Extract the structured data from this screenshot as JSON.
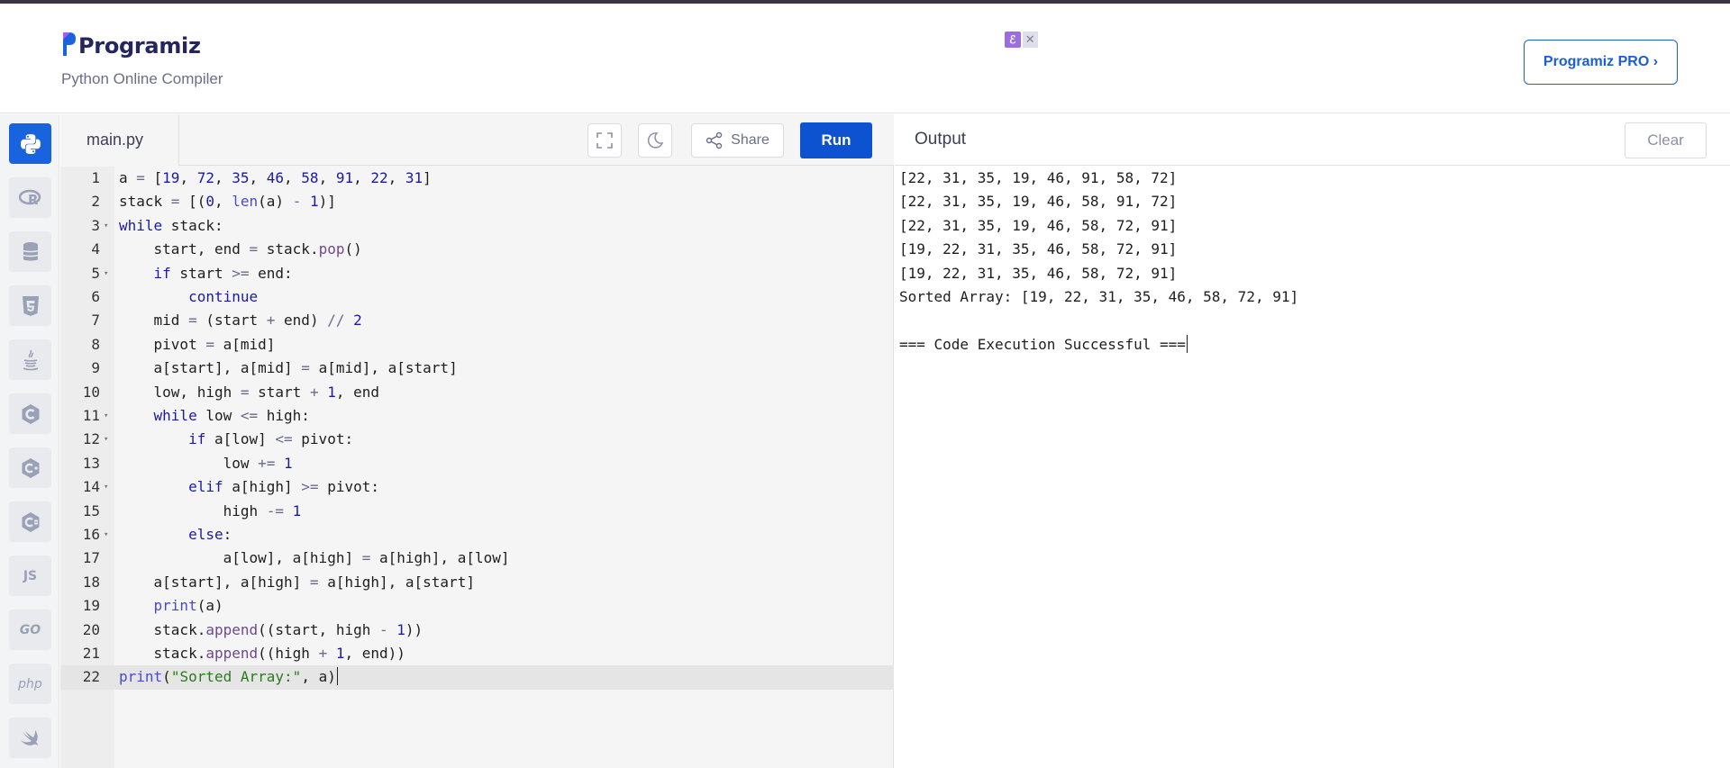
{
  "header": {
    "brand": "Programiz",
    "subtitle": "Python Online Compiler",
    "pro_button": "Programiz PRO ›"
  },
  "sidebar": {
    "items": [
      {
        "name": "python",
        "icon": "python-icon",
        "active": true
      },
      {
        "name": "r",
        "icon": "r-icon"
      },
      {
        "name": "sql",
        "icon": "database-icon"
      },
      {
        "name": "html",
        "icon": "html5-icon"
      },
      {
        "name": "java",
        "icon": "java-icon"
      },
      {
        "name": "c",
        "icon": "c-icon"
      },
      {
        "name": "cpp",
        "icon": "cpp-icon"
      },
      {
        "name": "csharp",
        "icon": "csharp-icon"
      },
      {
        "name": "js",
        "label": "JS",
        "icon": "js-icon"
      },
      {
        "name": "go",
        "label": "GO",
        "icon": "go-icon"
      },
      {
        "name": "php",
        "label": "php",
        "icon": "php-icon"
      },
      {
        "name": "swift",
        "icon": "swift-icon"
      }
    ]
  },
  "editor": {
    "filename": "main.py",
    "share_label": "Share",
    "run_label": "Run",
    "lines": [
      "a = [19, 72, 35, 46, 58, 91, 22, 31]",
      "stack = [(0, len(a) - 1)]",
      "while stack:",
      "    start, end = stack.pop()",
      "    if start >= end:",
      "        continue",
      "    mid = (start + end) // 2",
      "    pivot = a[mid]",
      "    a[start], a[mid] = a[mid], a[start]",
      "    low, high = start + 1, end",
      "    while low <= high:",
      "        if a[low] <= pivot:",
      "            low += 1",
      "        elif a[high] >= pivot:",
      "            high -= 1",
      "        else:",
      "            a[low], a[high] = a[high], a[low]",
      "    a[start], a[high] = a[high], a[start]",
      "    print(a)",
      "    stack.append((start, high - 1))",
      "    stack.append((high + 1, end))",
      "print(\"Sorted Array:\", a)"
    ],
    "fold_lines": [
      3,
      5,
      11,
      12,
      14,
      16
    ],
    "active_line": 22
  },
  "output": {
    "title": "Output",
    "clear_label": "Clear",
    "lines": [
      "[22, 31, 35, 19, 46, 91, 58, 72]",
      "[22, 31, 35, 19, 46, 58, 91, 72]",
      "[22, 31, 35, 19, 46, 58, 72, 91]",
      "[19, 22, 31, 35, 46, 58, 72, 91]",
      "[19, 22, 31, 35, 46, 58, 72, 91]",
      "Sorted Array: [19, 22, 31, 35, 46, 58, 72, 91]",
      "",
      "=== Code Execution Successful ==="
    ]
  },
  "colors": {
    "keyword": "#1a1aa6",
    "number": "#1a1aa6",
    "string": "#2b7a1f",
    "builtin": "#4a4ad0",
    "method": "#6c4a8c",
    "run_button": "#0d52d1",
    "sidebar_active": "#1a63de"
  }
}
